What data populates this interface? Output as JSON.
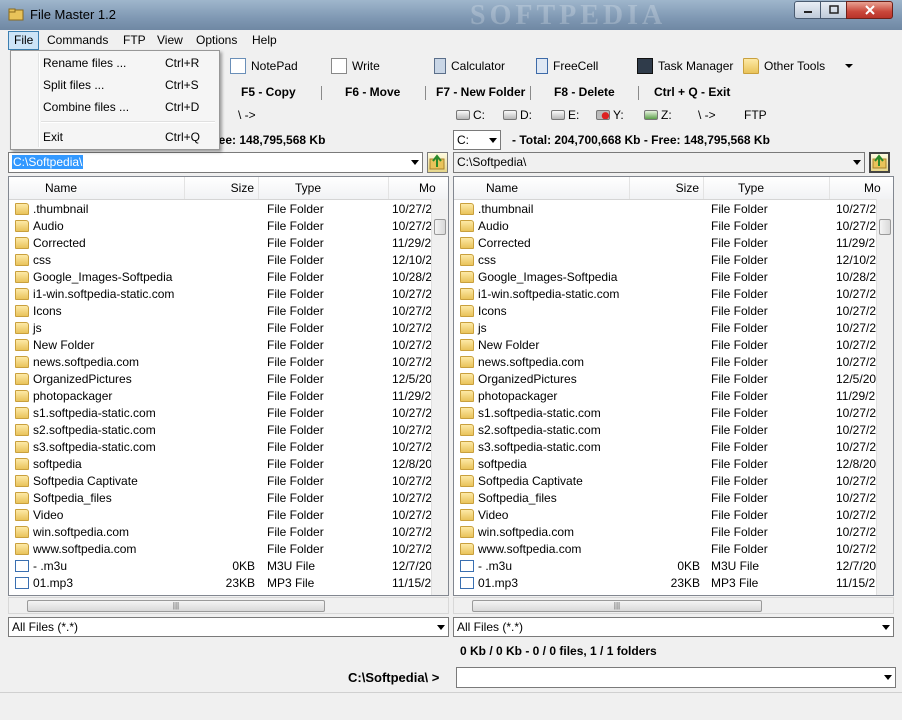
{
  "window": {
    "title": "File Master 1.2",
    "watermark": "SOFTPEDIA"
  },
  "menubar": {
    "items": [
      "File",
      "Commands",
      "FTP",
      "View",
      "Options",
      "Help"
    ]
  },
  "file_menu": {
    "items": [
      {
        "label": "Rename files ...",
        "shortcut": "Ctrl+R"
      },
      {
        "label": "Split files ...",
        "shortcut": "Ctrl+S"
      },
      {
        "label": "Combine files ...",
        "shortcut": "Ctrl+D"
      },
      {
        "label": "Exit",
        "shortcut": "Ctrl+Q"
      }
    ]
  },
  "toolbar": {
    "items": [
      "NotePad",
      "Write",
      "Calculator",
      "FreeCell",
      "Task Manager",
      "Other Tools"
    ]
  },
  "fkeys": [
    "F5 - Copy",
    "F6 - Move",
    "F7 - New Folder",
    "F8 - Delete",
    "Ctrl + Q - Exit"
  ],
  "left": {
    "drive_partial": "\\ ->",
    "totals_partial": "ree: 148,795,568 Kb",
    "path": "C:\\Softpedia\\",
    "filter": "All Files (*.*)"
  },
  "right": {
    "drives": [
      {
        "label": "C:"
      },
      {
        "label": "D:"
      },
      {
        "label": "E:"
      },
      {
        "label": "Y:"
      },
      {
        "label": "Z:"
      },
      {
        "label": "\\ ->"
      },
      {
        "label": "FTP"
      }
    ],
    "drive_select": "C:",
    "totals": "- Total: 204,700,668 Kb - Free: 148,795,568 Kb",
    "path": "C:\\Softpedia\\",
    "filter": "All Files (*.*)",
    "status": "0 Kb / 0 Kb - 0 / 0 files, 1 / 1 folders"
  },
  "columns": {
    "name": "Name",
    "size": "Size",
    "type": "Type",
    "date": "Mo"
  },
  "files": [
    {
      "name": ".thumbnail",
      "size": "",
      "type": "File Folder",
      "date": "10/27/2",
      "icon": "folder"
    },
    {
      "name": "Audio",
      "size": "",
      "type": "File Folder",
      "date": "10/27/2",
      "icon": "folder"
    },
    {
      "name": "Corrected",
      "size": "",
      "type": "File Folder",
      "date": "11/29/2",
      "icon": "folder"
    },
    {
      "name": "css",
      "size": "",
      "type": "File Folder",
      "date": "12/10/2",
      "icon": "folder"
    },
    {
      "name": "Google_Images-Softpedia",
      "size": "",
      "type": "File Folder",
      "date": "10/28/2",
      "icon": "folder"
    },
    {
      "name": "i1-win.softpedia-static.com",
      "size": "",
      "type": "File Folder",
      "date": "10/27/2",
      "icon": "folder"
    },
    {
      "name": "Icons",
      "size": "",
      "type": "File Folder",
      "date": "10/27/2",
      "icon": "folder"
    },
    {
      "name": "js",
      "size": "",
      "type": "File Folder",
      "date": "10/27/2",
      "icon": "folder"
    },
    {
      "name": "New Folder",
      "size": "",
      "type": "File Folder",
      "date": "10/27/2",
      "icon": "folder"
    },
    {
      "name": "news.softpedia.com",
      "size": "",
      "type": "File Folder",
      "date": "10/27/2",
      "icon": "folder"
    },
    {
      "name": "OrganizedPictures",
      "size": "",
      "type": "File Folder",
      "date": "12/5/20",
      "icon": "folder"
    },
    {
      "name": "photopackager",
      "size": "",
      "type": "File Folder",
      "date": "11/29/2",
      "icon": "folder"
    },
    {
      "name": "s1.softpedia-static.com",
      "size": "",
      "type": "File Folder",
      "date": "10/27/2",
      "icon": "folder"
    },
    {
      "name": "s2.softpedia-static.com",
      "size": "",
      "type": "File Folder",
      "date": "10/27/2",
      "icon": "folder"
    },
    {
      "name": "s3.softpedia-static.com",
      "size": "",
      "type": "File Folder",
      "date": "10/27/2",
      "icon": "folder"
    },
    {
      "name": "softpedia",
      "size": "",
      "type": "File Folder",
      "date": "12/8/20",
      "icon": "folder"
    },
    {
      "name": "Softpedia Captivate",
      "size": "",
      "type": "File Folder",
      "date": "10/27/2",
      "icon": "folder"
    },
    {
      "name": "Softpedia_files",
      "size": "",
      "type": "File Folder",
      "date": "10/27/2",
      "icon": "folder"
    },
    {
      "name": "Video",
      "size": "",
      "type": "File Folder",
      "date": "10/27/2",
      "icon": "folder"
    },
    {
      "name": "win.softpedia.com",
      "size": "",
      "type": "File Folder",
      "date": "10/27/2",
      "icon": "folder"
    },
    {
      "name": "www.softpedia.com",
      "size": "",
      "type": "File Folder",
      "date": "10/27/2",
      "icon": "folder"
    },
    {
      "name": "- .m3u",
      "size": "0KB",
      "type": "M3U File",
      "date": "12/7/20",
      "icon": "file"
    },
    {
      "name": "01.mp3",
      "size": "23KB",
      "type": "MP3 File",
      "date": "11/15/2",
      "icon": "file"
    }
  ],
  "cmdline": {
    "label": "C:\\Softpedia\\ >",
    "value": ""
  },
  "colors": {
    "menu_highlight": "#cde4f7",
    "selection": "#3399ff",
    "close_button": "#c9473a"
  }
}
